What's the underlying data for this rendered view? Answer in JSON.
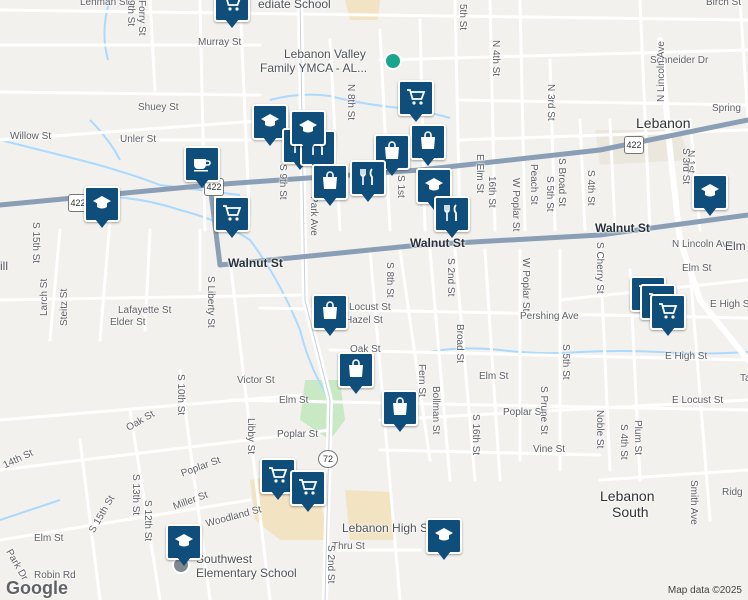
{
  "map": {
    "attribution": "Map data ©2025",
    "logo": "Google",
    "colors": {
      "road": "#ffffff",
      "highway": "#8a9fb5",
      "water": "#aadaff",
      "park": "#c9e8c4",
      "school": "#f2e3c3",
      "marker": "#0f4d7a"
    },
    "streets": [
      "Lehman St",
      "Murray St",
      "Shuey St",
      "Willow St",
      "Unler St",
      "Walnut St",
      "Lafayette St",
      "Elder St",
      "Locust St",
      "Hazel St",
      "Oak St",
      "Victor St",
      "Libby St",
      "Elm St",
      "Poplar St",
      "Miller St",
      "Woodland St",
      "Thru St",
      "Robin Rd",
      "Park Dr",
      "Vine St",
      "Pershing Ave",
      "Fern St",
      "Bollman St",
      "Broad St",
      "Cherry St",
      "Prune St",
      "Peach St",
      "Noble St",
      "Plum St",
      "Smith Ave",
      "Larch St",
      "Steitz St",
      "Schneider Dr",
      "Spring",
      "Ridg",
      "N 4th St",
      "N 3rd St",
      "N 8th St",
      "5th St",
      "N 1st",
      "N Lincoln Ave",
      "Elm St",
      "E High St",
      "E Locust St",
      "E Elm St",
      "W Poplar St",
      "S 5th St",
      "S 4th St",
      "S 3rd St",
      "S 2nd St",
      "S 1st",
      "S 6th St",
      "S 7th St",
      "S 8th St",
      "S 9th St",
      "S Liberty St",
      "S 10th St",
      "S 12th St",
      "S 13th St",
      "S 15th St",
      "S 16th St",
      "16th St",
      "S Broad St",
      "S Cherry St",
      "S Prune St",
      "S 2nd St",
      "Park Ave",
      "Forry St",
      "9th St",
      "13th St",
      "14th St",
      "Tamroe St",
      "Ln",
      "Elm St",
      "S 3rd St",
      "S 2nd St",
      "S 2nd St",
      "S 3rd St",
      "S 6th St"
    ],
    "places": {
      "lebanon": "Lebanon",
      "lebanon_south_1": "Lebanon",
      "lebanon_south_2": "South",
      "ymca_1": "Lebanon Valley",
      "ymca_2": "Family YMCA - AL...",
      "high_school": "Lebanon High School",
      "southwest_1": "Southwest",
      "southwest_2": "Elementary School",
      "intermediate_school": "ediate School",
      "elm": "Elm",
      "ill": "ill",
      "bird": "Birch St"
    },
    "routes": {
      "r422a": "422",
      "r422b": "422",
      "r422c": "422",
      "r72": "72"
    },
    "markers": [
      {
        "icon": "shopping-cart-icon"
      },
      {
        "icon": "graduation-cap-icon"
      },
      {
        "icon": "shopping-cart-icon"
      },
      {
        "icon": "graduation-cap-icon"
      },
      {
        "icon": "coffee-cup-icon"
      },
      {
        "icon": "shopping-cart-icon"
      },
      {
        "icon": "graduation-cap-icon"
      },
      {
        "icon": "restaurant-icon"
      },
      {
        "icon": "shopping-bag-icon"
      },
      {
        "icon": "shopping-bag-icon"
      },
      {
        "icon": "restaurant-icon"
      },
      {
        "icon": "restaurant-icon"
      },
      {
        "icon": "shopping-bag-icon"
      },
      {
        "icon": "graduation-cap-icon"
      },
      {
        "icon": "restaurant-icon"
      },
      {
        "icon": "shopping-bag-icon"
      },
      {
        "icon": "shopping-bag-icon"
      },
      {
        "icon": "shopping-bag-icon"
      },
      {
        "icon": "shopping-cart-icon"
      },
      {
        "icon": "shopping-cart-icon"
      },
      {
        "icon": "graduation-cap-icon"
      },
      {
        "icon": "graduation-cap-icon"
      },
      {
        "icon": "graduation-cap-icon"
      },
      {
        "icon": "shopping-cart-icon"
      },
      {
        "icon": "shopping-cart-icon"
      },
      {
        "icon": "shopping-cart-icon"
      }
    ]
  }
}
